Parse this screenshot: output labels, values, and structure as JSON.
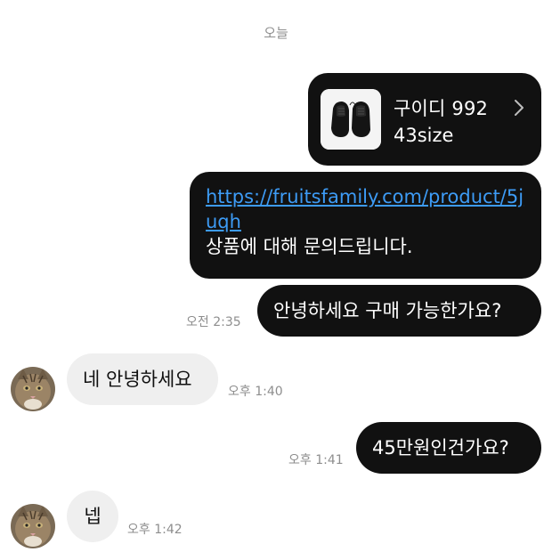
{
  "date_separator": "오늘",
  "messages": {
    "product_card": {
      "title": "구이디 992",
      "size": "43size",
      "thumb_icon": "shoes-photo",
      "chevron_icon": "chevron-right-icon"
    },
    "link_message": {
      "url": "https://fruitsfamily.com/product/5juqh",
      "text": "상품에 대해 문의드립니다."
    },
    "out_1": {
      "text": "안녕하세요 구매 가능한가요?",
      "time": "오전 2:35"
    },
    "in_1": {
      "text": "네 안녕하세요",
      "time": "오후 1:40"
    },
    "out_2": {
      "text": "45만원인건가요?",
      "time": "오후 1:41"
    },
    "in_2": {
      "text": "넵",
      "time": "오후 1:42"
    }
  },
  "colors": {
    "outgoing_bubble": "#111111",
    "incoming_bubble": "#efefef",
    "link": "#3d9bf5",
    "timestamp": "#8e8e8e"
  }
}
